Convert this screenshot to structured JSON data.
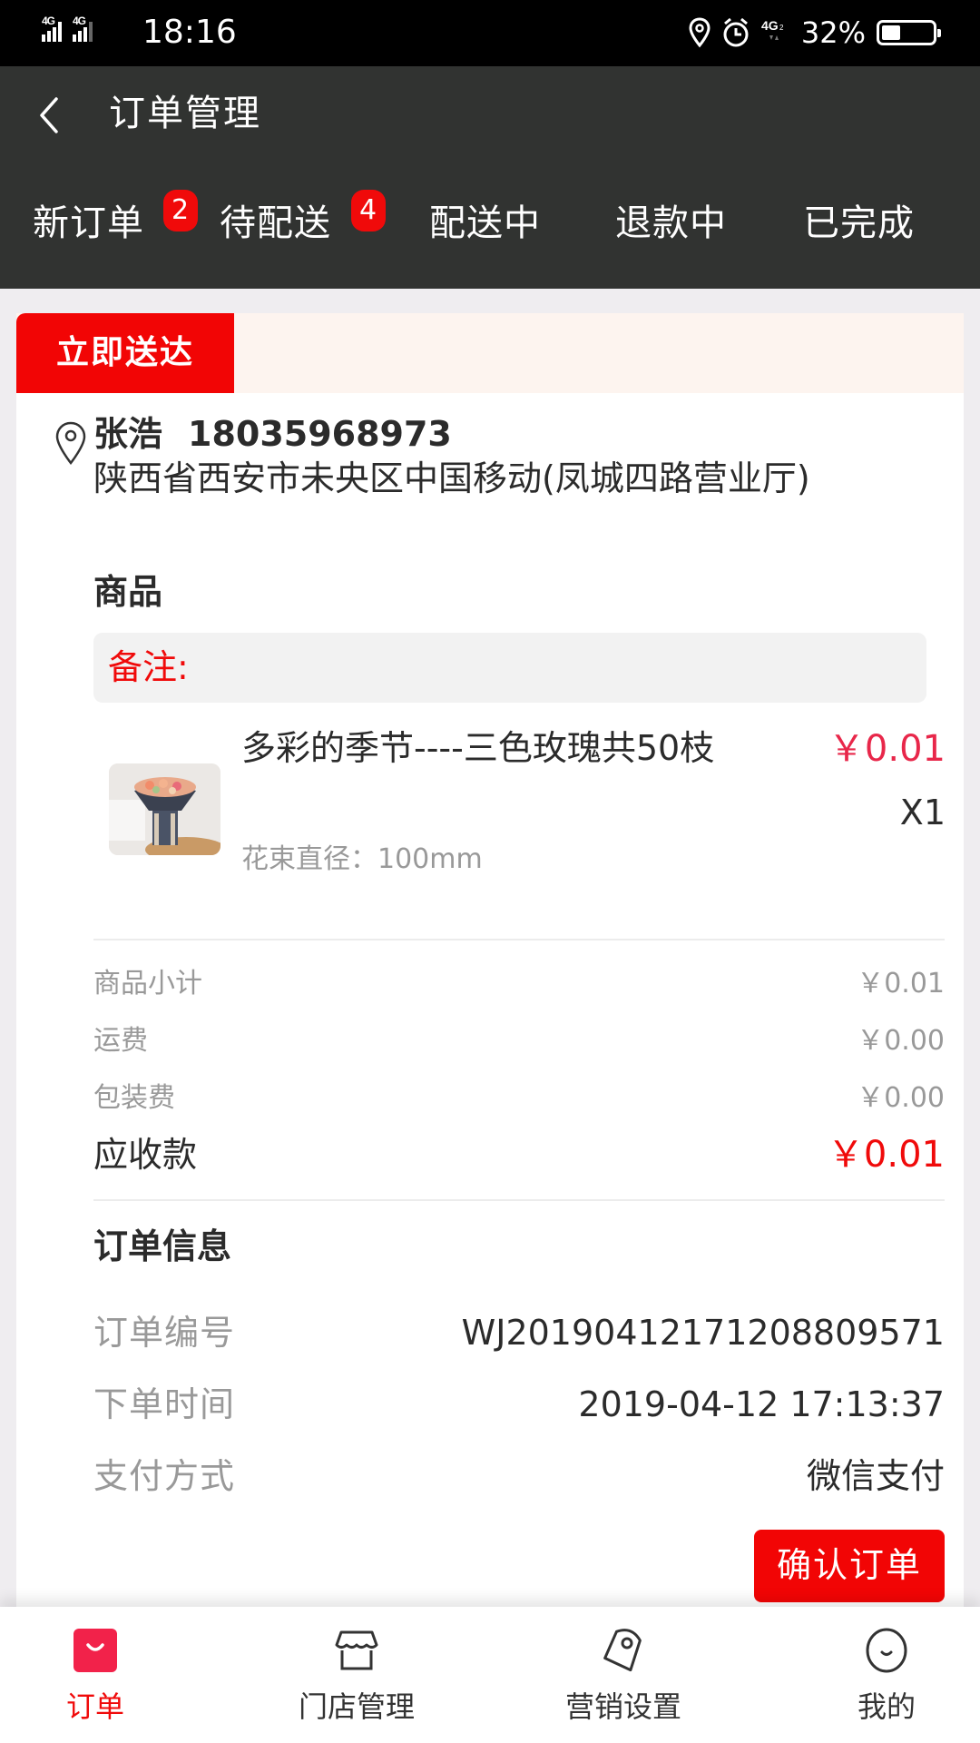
{
  "status_bar": {
    "signal": "4G 4G",
    "time": "18:16",
    "network": "4G",
    "battery": "32%",
    "battery_level": 0.32
  },
  "header": {
    "title": "订单管理",
    "back_icon": "chevron-left-icon"
  },
  "tabs": [
    {
      "label": "新订单",
      "badge": "2",
      "active": true
    },
    {
      "label": "待配送",
      "badge": "4",
      "active": false
    },
    {
      "label": "配送中",
      "badge": null,
      "active": false
    },
    {
      "label": "退款中",
      "badge": null,
      "active": false
    },
    {
      "label": "已完成",
      "badge": null,
      "active": false
    }
  ],
  "order": {
    "delivery_tag": "立即送达",
    "customer": {
      "name": "张浩",
      "phone": "18035968973",
      "address": "陕西省西安市未央区中国移动(凤城四路营业厅)"
    },
    "products_title": "商品",
    "remark_label": "备注:",
    "remark_value": "",
    "items": [
      {
        "name": "多彩的季节----三色玫瑰共50枝",
        "spec": "花束直径：100mm",
        "price": "￥0.01",
        "quantity": "X1"
      }
    ],
    "fees": [
      {
        "label": "商品小计",
        "value": "￥0.01"
      },
      {
        "label": "运费",
        "value": "￥0.00"
      },
      {
        "label": "包装费",
        "value": "￥0.00"
      }
    ],
    "total": {
      "label": "应收款",
      "value": "￥0.01"
    },
    "info_title": "订单信息",
    "info": [
      {
        "label": "订单编号",
        "value": "WJ20190412171208809571"
      },
      {
        "label": "下单时间",
        "value": "2019-04-12 17:13:37"
      },
      {
        "label": "支付方式",
        "value": "微信支付"
      }
    ],
    "confirm_button": "确认订单"
  },
  "bottom_nav": [
    {
      "label": "订单",
      "icon": "order-bag-icon",
      "active": true
    },
    {
      "label": "门店管理",
      "icon": "store-icon",
      "active": false
    },
    {
      "label": "营销设置",
      "icon": "tag-icon",
      "active": false
    },
    {
      "label": "我的",
      "icon": "smile-profile-icon",
      "active": false
    }
  ],
  "colors": {
    "header_bg": "#313331",
    "accent_red": "#f20505",
    "tab_indicator": "#e8274a",
    "price_pink": "#e8274a",
    "page_bg": "#efedf0"
  }
}
